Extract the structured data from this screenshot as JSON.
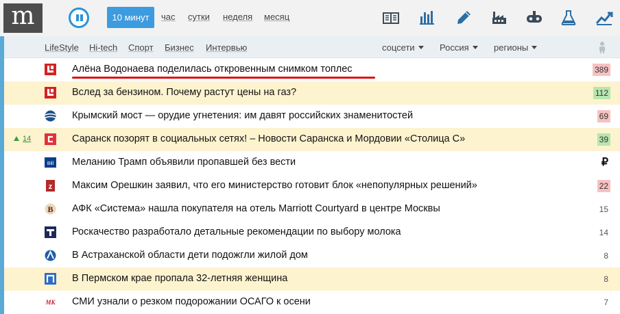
{
  "header": {
    "logo_letter": "m",
    "periods": {
      "active": "10 минут",
      "items": [
        "час",
        "сутки",
        "неделя",
        "месяц"
      ]
    },
    "icons": [
      "columns-icon",
      "bar-chart-icon",
      "pen-icon",
      "factory-icon",
      "gamepad-icon",
      "flask-icon",
      "trend-up-icon"
    ]
  },
  "nav": {
    "categories": [
      "LifeStyle",
      "Hi-tech",
      "Спорт",
      "Бизнес",
      "Интервью"
    ],
    "dropdowns": [
      "соцсети",
      "Россия",
      "регионы"
    ]
  },
  "news": [
    {
      "title": "Алёна Водонаева поделилась откровенным снимком топлес",
      "count": "389",
      "badge": "red",
      "highlight": false,
      "source_icon": "l-logo-icon",
      "rank": ""
    },
    {
      "title": "Вслед за бензином. Почему растут цены на газ?",
      "count": "112",
      "badge": "green",
      "highlight": true,
      "source_icon": "l-logo-icon",
      "rank": ""
    },
    {
      "title": "Крымский мост — орудие угнетения: им давят российских знаменитостей",
      "count": "69",
      "badge": "red",
      "highlight": false,
      "source_icon": "globe-logo-icon",
      "rank": ""
    },
    {
      "title": "Саранск позорят в социальных сетях! – Новости Саранска и Мордовии «Столица С»",
      "count": "39",
      "badge": "green",
      "highlight": true,
      "source_icon": "c-logo-icon",
      "rank": "14"
    },
    {
      "title": "Меланию Трамп объявили пропавшей без вести",
      "count": "₽",
      "badge": "ruble",
      "highlight": false,
      "source_icon": "bill-logo-icon",
      "rank": ""
    },
    {
      "title": "Максим Орешкин заявил, что его министерство готовит блок «непопулярных решений»",
      "count": "22",
      "badge": "red",
      "highlight": false,
      "source_icon": "z-logo-icon",
      "rank": ""
    },
    {
      "title": "АФК «Система» нашла покупателя на отель Marriott Courtyard в центре Москвы",
      "count": "15",
      "badge": "plain",
      "highlight": false,
      "source_icon": "v-logo-icon",
      "rank": ""
    },
    {
      "title": "Роскачество разработало детальные рекомендации по выбору молока",
      "count": "14",
      "badge": "plain",
      "highlight": false,
      "source_icon": "t-logo-icon",
      "rank": ""
    },
    {
      "title": "В Астраханской области дети подожгли жилой дом",
      "count": "8",
      "badge": "plain",
      "highlight": false,
      "source_icon": "a-logo-icon",
      "rank": ""
    },
    {
      "title": "В Пермском крае пропала 32-летняя женщина",
      "count": "8",
      "badge": "plain",
      "highlight": true,
      "source_icon": "p-logo-icon",
      "rank": ""
    },
    {
      "title": "СМИ узнали о резком подорожании ОСАГО к осени",
      "count": "7",
      "badge": "plain",
      "highlight": false,
      "source_icon": "mk-logo-icon",
      "rank": ""
    }
  ],
  "colors": {
    "accent": "#3d9bdf",
    "highlight_row": "#fdf3cf",
    "badge_red": "#f7c1c1",
    "badge_green": "#b7e6ae"
  }
}
